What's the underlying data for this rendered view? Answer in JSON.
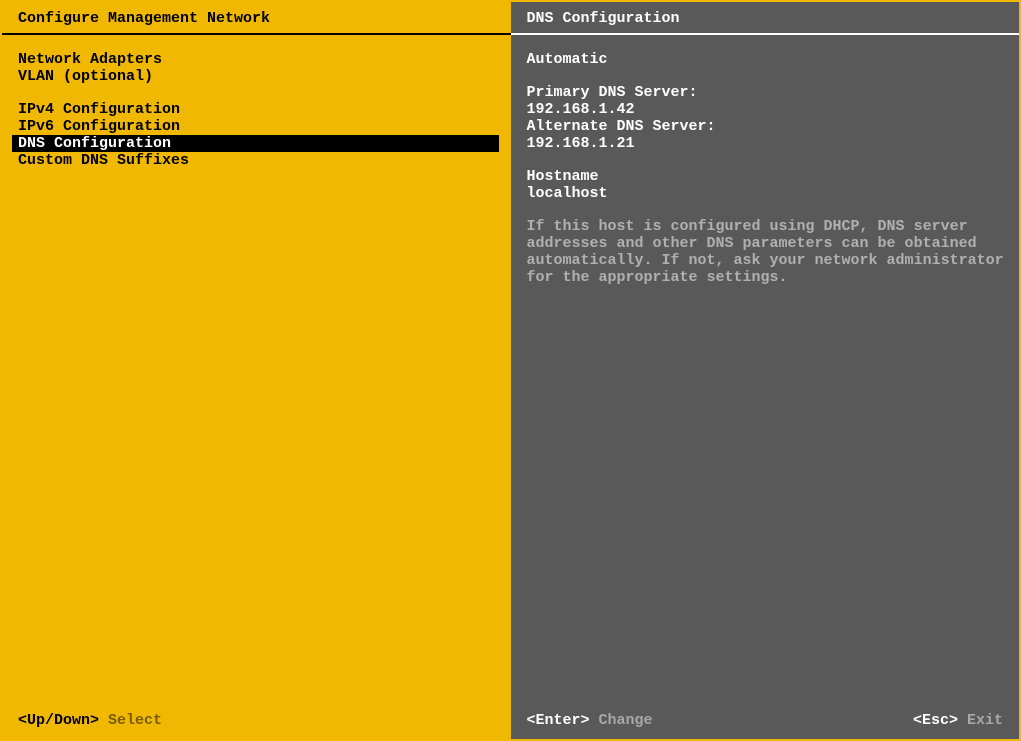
{
  "left": {
    "title": "Configure Management Network",
    "menu": {
      "group1": [
        {
          "label": "Network Adapters",
          "selected": false
        },
        {
          "label": "VLAN (optional)",
          "selected": false
        }
      ],
      "group2": [
        {
          "label": "IPv4 Configuration",
          "selected": false
        },
        {
          "label": "IPv6 Configuration",
          "selected": false
        },
        {
          "label": "DNS Configuration",
          "selected": true
        },
        {
          "label": "Custom DNS Suffixes",
          "selected": false
        }
      ]
    },
    "footer": {
      "key": "<Up/Down>",
      "action": "Select"
    }
  },
  "right": {
    "title": "DNS Configuration",
    "mode": "Automatic",
    "primary_label": "Primary DNS Server:",
    "primary_value": "192.168.1.42",
    "alternate_label": "Alternate DNS Server:",
    "alternate_value": "192.168.1.21",
    "hostname_label": "Hostname",
    "hostname_value": "localhost",
    "help": "If this host is configured using DHCP, DNS server addresses and other DNS parameters can be obtained automatically. If not, ask your network administrator for the appropriate settings.",
    "footer": {
      "enter_key": "<Enter>",
      "enter_action": "Change",
      "esc_key": "<Esc>",
      "esc_action": "Exit"
    }
  }
}
